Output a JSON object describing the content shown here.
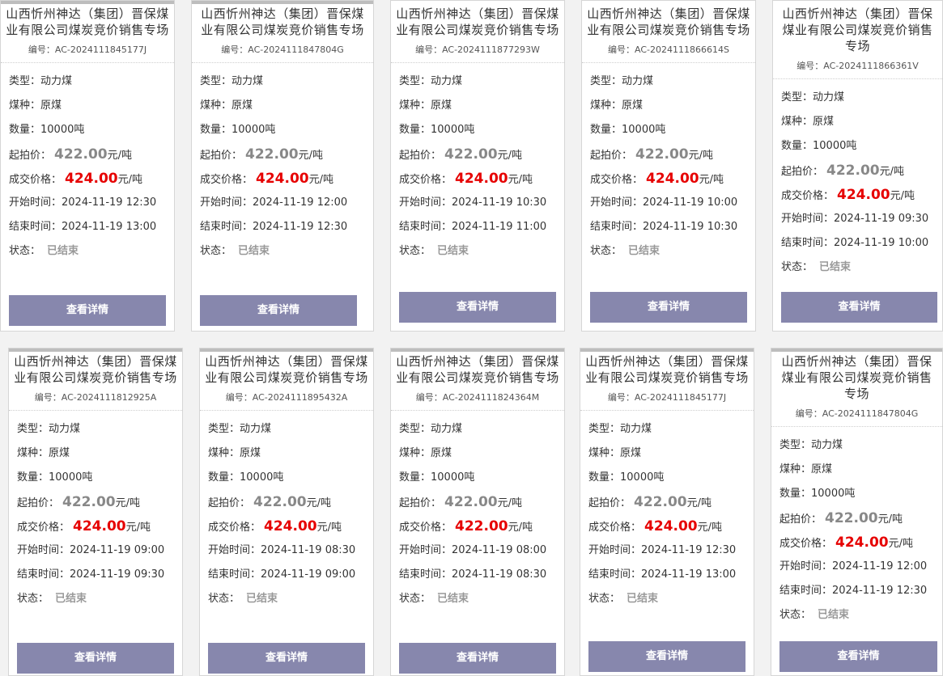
{
  "cards": [
    {
      "title": "山西忻州神达（集团）晋保煤业有限公司煤炭竞价销售专场",
      "code": "编号：AC-2024111845177J",
      "type_label": "类型：",
      "type": "动力煤",
      "coal_label": "煤种：",
      "coal": "原煤",
      "qty_label": "数量：",
      "qty": "10000吨",
      "start_label": "起拍价：",
      "start_price": "422.00",
      "start_unit": "元/吨",
      "deal_label": "成交价格：",
      "deal_price": "424.00",
      "deal_unit": "元/吨",
      "begin_label": "开始时间：",
      "begin": "2024-11-19 12:30",
      "end_label": "结束时间：",
      "end": "2024-11-19 13:00",
      "status_label": "状态：",
      "status": "已结束",
      "button": "查看详情"
    },
    {
      "title": "山西忻州神达（集团）晋保煤业有限公司煤炭竞价销售专场",
      "code": "编号：AC-2024111847804G",
      "type_label": "类型：",
      "type": "动力煤",
      "coal_label": "煤种：",
      "coal": "原煤",
      "qty_label": "数量：",
      "qty": "10000吨",
      "start_label": "起拍价：",
      "start_price": "422.00",
      "start_unit": "元/吨",
      "deal_label": "成交价格：",
      "deal_price": "424.00",
      "deal_unit": "元/吨",
      "begin_label": "开始时间：",
      "begin": "2024-11-19 12:00",
      "end_label": "结束时间：",
      "end": "2024-11-19 12:30",
      "status_label": "状态：",
      "status": "已结束",
      "button": "查看详情"
    },
    {
      "title": "山西忻州神达（集团）晋保煤业有限公司煤炭竞价销售专场",
      "code": "编号：AC-2024111877293W",
      "type_label": "类型：",
      "type": "动力煤",
      "coal_label": "煤种：",
      "coal": "原煤",
      "qty_label": "数量：",
      "qty": "10000吨",
      "start_label": "起拍价：",
      "start_price": "422.00",
      "start_unit": "元/吨",
      "deal_label": "成交价格：",
      "deal_price": "424.00",
      "deal_unit": "元/吨",
      "begin_label": "开始时间：",
      "begin": "2024-11-19 10:30",
      "end_label": "结束时间：",
      "end": "2024-11-19 11:00",
      "status_label": "状态：",
      "status": "已结束",
      "button": "查看详情"
    },
    {
      "title": "山西忻州神达（集团）晋保煤业有限公司煤炭竞价销售专场",
      "code": "编号：AC-2024111866614S",
      "type_label": "类型：",
      "type": "动力煤",
      "coal_label": "煤种：",
      "coal": "原煤",
      "qty_label": "数量：",
      "qty": "10000吨",
      "start_label": "起拍价：",
      "start_price": "422.00",
      "start_unit": "元/吨",
      "deal_label": "成交价格：",
      "deal_price": "424.00",
      "deal_unit": "元/吨",
      "begin_label": "开始时间：",
      "begin": "2024-11-19 10:00",
      "end_label": "结束时间：",
      "end": "2024-11-19 10:30",
      "status_label": "状态：",
      "status": "已结束",
      "button": "查看详情"
    },
    {
      "title": "山西忻州神达（集团）晋保煤业有限公司煤炭竞价销售专场",
      "code": "编号：AC-2024111866361V",
      "type_label": "类型：",
      "type": "动力煤",
      "coal_label": "煤种：",
      "coal": "原煤",
      "qty_label": "数量：",
      "qty": "10000吨",
      "start_label": "起拍价：",
      "start_price": "422.00",
      "start_unit": "元/吨",
      "deal_label": "成交价格：",
      "deal_price": "424.00",
      "deal_unit": "元/吨",
      "begin_label": "开始时间：",
      "begin": "2024-11-19 09:30",
      "end_label": "结束时间：",
      "end": "2024-11-19 10:00",
      "status_label": "状态：",
      "status": "已结束",
      "button": "查看详情"
    },
    {
      "title": "山西忻州神达（集团）晋保煤业有限公司煤炭竞价销售专场",
      "code": "编号：AC-2024111812925A",
      "type_label": "类型：",
      "type": "动力煤",
      "coal_label": "煤种：",
      "coal": "原煤",
      "qty_label": "数量：",
      "qty": "10000吨",
      "start_label": "起拍价：",
      "start_price": "422.00",
      "start_unit": "元/吨",
      "deal_label": "成交价格：",
      "deal_price": "424.00",
      "deal_unit": "元/吨",
      "begin_label": "开始时间：",
      "begin": "2024-11-19 09:00",
      "end_label": "结束时间：",
      "end": "2024-11-19 09:30",
      "status_label": "状态：",
      "status": "已结束",
      "button": "查看详情"
    },
    {
      "title": "山西忻州神达（集团）晋保煤业有限公司煤炭竞价销售专场",
      "code": "编号：AC-2024111895432A",
      "type_label": "类型：",
      "type": "动力煤",
      "coal_label": "煤种：",
      "coal": "原煤",
      "qty_label": "数量：",
      "qty": "10000吨",
      "start_label": "起拍价：",
      "start_price": "422.00",
      "start_unit": "元/吨",
      "deal_label": "成交价格：",
      "deal_price": "424.00",
      "deal_unit": "元/吨",
      "begin_label": "开始时间：",
      "begin": "2024-11-19 08:30",
      "end_label": "结束时间：",
      "end": "2024-11-19 09:00",
      "status_label": "状态：",
      "status": "已结束",
      "button": "查看详情"
    },
    {
      "title": "山西忻州神达（集团）晋保煤业有限公司煤炭竞价销售专场",
      "code": "编号：AC-2024111824364M",
      "type_label": "类型：",
      "type": "动力煤",
      "coal_label": "煤种：",
      "coal": "原煤",
      "qty_label": "数量：",
      "qty": "10000吨",
      "start_label": "起拍价：",
      "start_price": "422.00",
      "start_unit": "元/吨",
      "deal_label": "成交价格：",
      "deal_price": "422.00",
      "deal_unit": "元/吨",
      "begin_label": "开始时间：",
      "begin": "2024-11-19 08:00",
      "end_label": "结束时间：",
      "end": "2024-11-19 08:30",
      "status_label": "状态：",
      "status": "已结束",
      "button": "查看详情"
    },
    {
      "title": "山西忻州神达（集团）晋保煤业有限公司煤炭竞价销售专场",
      "code": "编号：AC-2024111845177J",
      "type_label": "类型：",
      "type": "动力煤",
      "coal_label": "煤种：",
      "coal": "原煤",
      "qty_label": "数量：",
      "qty": "10000吨",
      "start_label": "起拍价：",
      "start_price": "422.00",
      "start_unit": "元/吨",
      "deal_label": "成交价格：",
      "deal_price": "424.00",
      "deal_unit": "元/吨",
      "begin_label": "开始时间：",
      "begin": "2024-11-19 12:30",
      "end_label": "结束时间：",
      "end": "2024-11-19 13:00",
      "status_label": "状态：",
      "status": "已结束",
      "button": "查看详情"
    },
    {
      "title": "山西忻州神达（集团）晋保煤业有限公司煤炭竞价销售专场",
      "code": "编号：AC-2024111847804G",
      "type_label": "类型：",
      "type": "动力煤",
      "coal_label": "煤种：",
      "coal": "原煤",
      "qty_label": "数量：",
      "qty": "10000吨",
      "start_label": "起拍价：",
      "start_price": "422.00",
      "start_unit": "元/吨",
      "deal_label": "成交价格：",
      "deal_price": "424.00",
      "deal_unit": "元/吨",
      "begin_label": "开始时间：",
      "begin": "2024-11-19 12:00",
      "end_label": "结束时间：",
      "end": "2024-11-19 12:30",
      "status_label": "状态：",
      "status": "已结束",
      "button": "查看详情"
    }
  ]
}
